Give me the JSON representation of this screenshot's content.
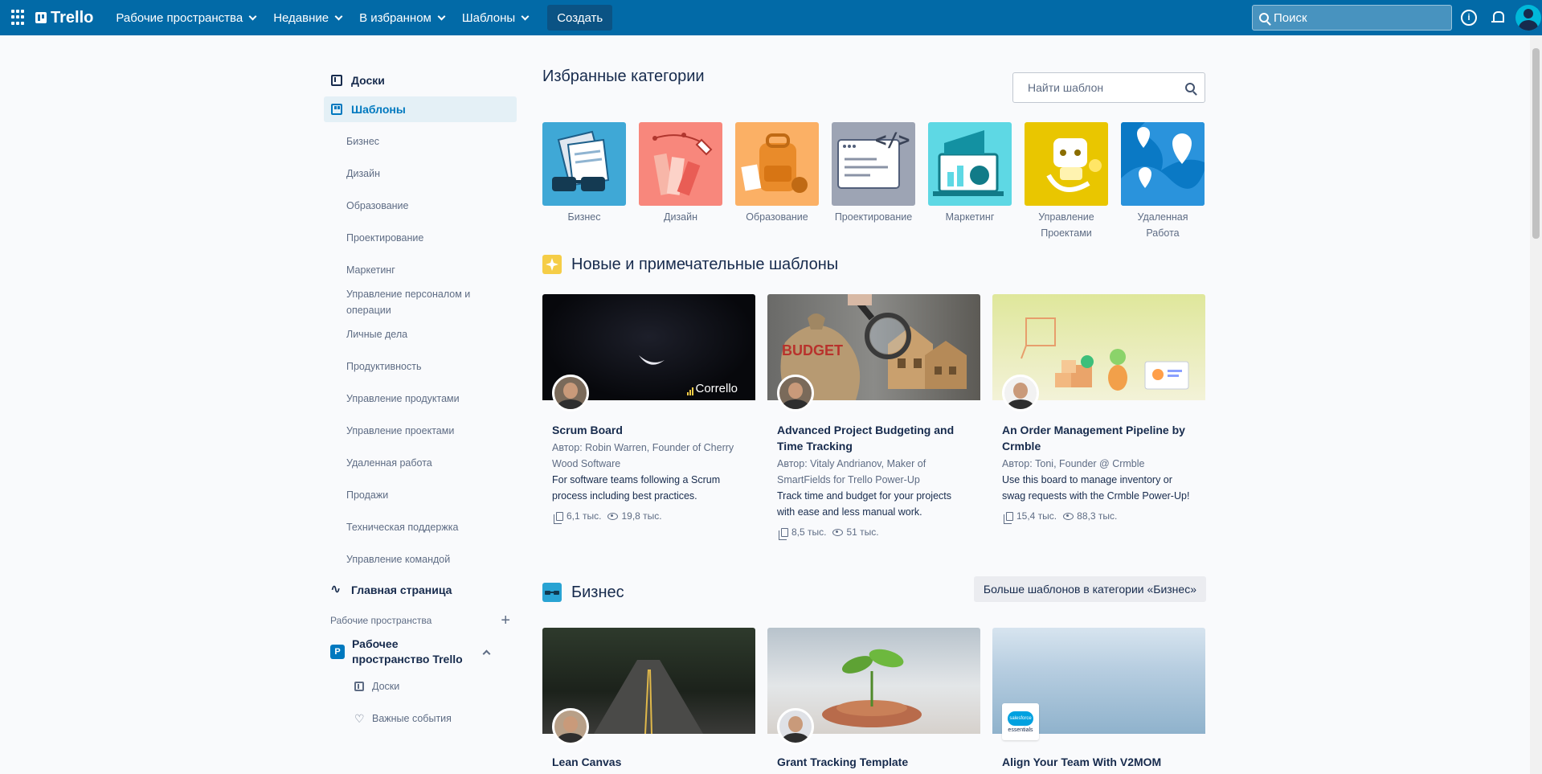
{
  "header": {
    "logo": "Trello",
    "nav": [
      {
        "label": "Рабочие пространства"
      },
      {
        "label": "Недавние"
      },
      {
        "label": "В избранном"
      },
      {
        "label": "Шаблоны"
      }
    ],
    "create_label": "Создать",
    "search_placeholder": "Поиск",
    "icons": [
      "apps-icon",
      "info-icon",
      "bell-icon",
      "avatar"
    ]
  },
  "sidebar": {
    "boards_label": "Доски",
    "templates_label": "Шаблоны",
    "categories": [
      "Бизнес",
      "Дизайн",
      "Образование",
      "Проектирование",
      "Маркетинг",
      "Управление персоналом и операции",
      "Личные дела",
      "Продуктивность",
      "Управление продуктами",
      "Управление проектами",
      "Удаленная работа",
      "Продажи",
      "Техническая поддержка",
      "Управление командой"
    ],
    "home_label": "Главная страница",
    "workspaces_label": "Рабочие пространства",
    "workspace": {
      "badge": "P",
      "name": "Рабочее пространство Trello",
      "items": [
        "Доски",
        "Важные события"
      ]
    }
  },
  "main": {
    "featured_title": "Избранные категории",
    "search_placeholder": "Найти шаблон",
    "featured_categories": [
      {
        "label": "Бизнес",
        "color": "#3fa8d6"
      },
      {
        "label": "Дизайн",
        "color": "#f8877c"
      },
      {
        "label": "Образование",
        "color": "#fbb065"
      },
      {
        "label": "Проектирование",
        "color": "#9da4b4"
      },
      {
        "label": "Маркетинг",
        "color": "#5ed8e4"
      },
      {
        "label": "Управление Проектами",
        "color": "#e9c600"
      },
      {
        "label": "Удаленная Работа",
        "color": "#0a79c5"
      }
    ],
    "new_section": {
      "title": "Новые и примечательные шаблоны",
      "cards": [
        {
          "title": "Scrum Board",
          "author": "Автор: Robin Warren, Founder of Cherry Wood Software",
          "desc": "For software teams following a Scrum process including best practices.",
          "copies": "6,1 тыс.",
          "views": "19,8 тыс.",
          "brand": "Corrello"
        },
        {
          "title": "Advanced Project Budgeting and Time Tracking",
          "author": "Автор: Vitaly Andrianov, Maker of SmartFields for Trello Power-Up",
          "desc": "Track time and budget for your projects with ease and less manual work.",
          "copies": "8,5 тыс.",
          "views": "51 тыс.",
          "brand": "BUDGET"
        },
        {
          "title": "An Order Management Pipeline by Crmble",
          "author": "Автор: Toni, Founder @ Crmble",
          "desc": "Use this board to manage inventory or swag requests with the Crmble Power-Up!",
          "copies": "15,4 тыс.",
          "views": "88,3 тыс."
        }
      ]
    },
    "business_section": {
      "title": "Бизнес",
      "more_label": "Больше шаблонов в категории «Бизнес»",
      "cards": [
        {
          "title": "Lean Canvas"
        },
        {
          "title": "Grant Tracking Template"
        },
        {
          "title": "Align Your Team With V2MOM",
          "badge_top": "salesforce",
          "badge_bottom": "essentials"
        }
      ]
    }
  }
}
